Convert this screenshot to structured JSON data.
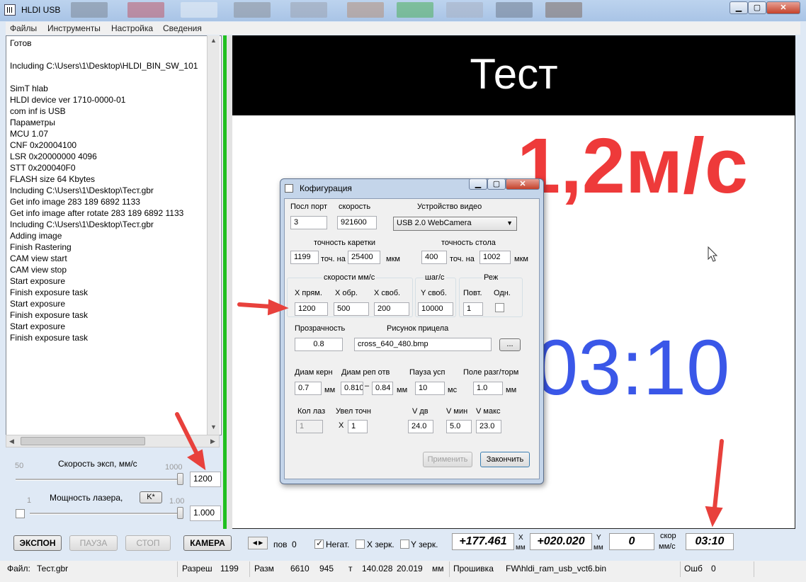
{
  "window": {
    "title": "HLDI USB"
  },
  "menu": [
    "Файлы",
    "Инструменты",
    "Настройка",
    "Сведения"
  ],
  "log": [
    "Готов",
    "",
    "Including C:\\Users\\1\\Desktop\\HLDI_BIN_SW_101",
    "",
    "SimT hlab",
    "HLDI device ver 1710-0000-01",
    "com inf is USB",
    "Параметры",
    "MCU 1.07",
    "CNF 0x20004100",
    "LSR 0x20000000 4096",
    "STT 0x200040F0",
    "FLASH size 64 Kbytes",
    "Including C:\\Users\\1\\Desktop\\Тест.gbr",
    "Get info image 283 189 6892 1133",
    "Get info image after rotate 283 189 6892 1133",
    "Including C:\\Users\\1\\Desktop\\Тест.gbr",
    "Adding image",
    "Finish Rastering",
    "CAM view start",
    "CAM view stop",
    "Start exposure",
    "Finish exposure task",
    "Start exposure",
    "Finish exposure task",
    "Start exposure",
    "Finish exposure task"
  ],
  "controls": {
    "speed": {
      "label": "Скорость эксп, мм/с",
      "min": "50",
      "max": "1000",
      "value": "1200",
      "level": 1.0
    },
    "laser": {
      "label": "Мощность лазера,",
      "k_button": "K*",
      "min": "1",
      "max": "1.00",
      "value": "1.000",
      "level": 1.0
    },
    "buttons": {
      "expose": "ЭКСПОН",
      "pause": "ПАУЗА",
      "stop": "СТОП",
      "camera": "КАМЕРА"
    }
  },
  "display": {
    "banner": "Тест",
    "speed_overlay": "1,2м/с",
    "timer_overlay": "03:10"
  },
  "dialog": {
    "title": "Кофигурация",
    "port_label": "Посл порт",
    "port_value": "3",
    "baud_label": "скорость",
    "baud_value": "921600",
    "video_label": "Устройство видео",
    "video_value": "USB 2.0 WebCamera",
    "carriage_label": "точность каретки",
    "carriage_pts": "1199",
    "carriage_per": "25400",
    "table_label": "точность стола",
    "table_pts": "400",
    "table_per": "1002",
    "pts_on": "точ. на",
    "um": "мкм",
    "speeds_group": "скорости мм/с",
    "x_fwd_label": "X прям.",
    "x_fwd": "1200",
    "x_rev_label": "X обр.",
    "x_rev": "500",
    "x_free_label": "X своб.",
    "x_free": "200",
    "step_group": "шаг/с",
    "y_free_label": "Y своб.",
    "y_free": "10000",
    "mode_group": "Реж",
    "repeat_label": "Повт.",
    "repeat_value": "1",
    "single_label": "Одн.",
    "transparency_label": "Прозрачность",
    "transparency_value": "0.8",
    "crosshair_label": "Рисунок прицела",
    "crosshair_value": "cross_640_480.bmp",
    "browse": "...",
    "core_diam_label": "Диам керн",
    "core_diam": "0.7",
    "ref_diam_label": "Диам реп отв",
    "ref_diam_a": "0.810",
    "ref_diam_b": "0.84",
    "dash": "–",
    "pause_label": "Пауза усп",
    "pause_value": "10",
    "accel_label": "Поле разг/торм",
    "accel_value": "1.0",
    "mm": "мм",
    "ms": "мс",
    "laser_count_label": "Кол лаз",
    "laser_count": "1",
    "point_zoom_label": "Увел точн",
    "x_mark": "X",
    "point_zoom": "1",
    "v_move_label": "V дв",
    "v_move": "24.0",
    "v_min_label": "V мин",
    "v_min": "5.0",
    "v_max_label": "V макс",
    "v_max": "23.0",
    "apply": "Применить",
    "finish": "Закончить"
  },
  "bottom": {
    "pos_label": "пов",
    "pos_value": "0",
    "negative_label": "Негат.",
    "x_mirror_label": "X зерк.",
    "y_mirror_label": "Y зерк.",
    "x_coord": "+177.461",
    "x_axis": "X",
    "y_coord": "+020.020",
    "y_axis": "Y",
    "mm": "мм",
    "speed_val": "0",
    "speed_lbl_a": "скор",
    "speed_lbl_b": "мм/с",
    "time_val": "03:10"
  },
  "status": {
    "file_label": "Файл:",
    "file": "Тест.gbr",
    "res_label": "Разреш",
    "res": "1199",
    "size_label": "Разм",
    "size_w": "6610",
    "size_h": "945",
    "t_label": "т",
    "t_a": "140.028",
    "t_b": "20.019",
    "t_unit": "мм",
    "fw_label": "Прошивка",
    "fw": "FW\\hldi_ram_usb_vct6.bin",
    "err_label": "Ошб",
    "err": "0"
  },
  "colors": {
    "overlay_red": "#ee3a3a",
    "overlay_blue": "#3a57e8",
    "splitter_green": "#20c020",
    "arrow": "#e8413c"
  }
}
